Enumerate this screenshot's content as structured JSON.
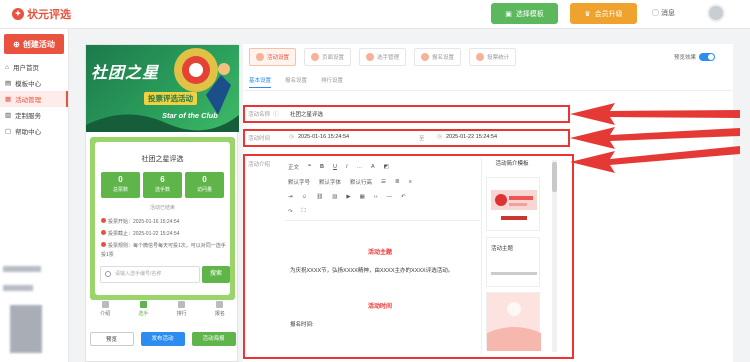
{
  "header": {
    "logo_text": "状元评选",
    "template_btn": "选择模板",
    "vip_btn": "会员升级",
    "message": "消息"
  },
  "sidebar": {
    "create": "创建活动",
    "items": [
      {
        "label": "用户首页",
        "active": false
      },
      {
        "label": "模板中心",
        "active": false
      },
      {
        "label": "活动管理",
        "active": true
      },
      {
        "label": "定制服务",
        "active": false
      },
      {
        "label": "帮助中心",
        "active": false
      }
    ]
  },
  "phone": {
    "banner_title": "社团之星",
    "banner_sub": "投票评选活动",
    "banner_en": "Star of the Club",
    "activity_title": "社团之星评选",
    "stats": [
      {
        "num": "0",
        "label": "总票数"
      },
      {
        "num": "6",
        "label": "选手数"
      },
      {
        "num": "0",
        "label": "访问量"
      }
    ],
    "ended": "活动已结束",
    "info": [
      "投票开始：2025-01-16 15:24:54",
      "投票截止：2025-01-22 15:24:54",
      "投票规则：每个微信号每天可投1次，可以对同一选手投1票"
    ],
    "search_placeholder": "请输入选手编号/名称",
    "search_btn": "搜索",
    "tabs": [
      "介绍",
      "选手",
      "排行",
      "报名"
    ],
    "btn_preview": "预览",
    "btn_publish": "发布活动",
    "btn_poster": "活动海报"
  },
  "panel": {
    "top_tabs": [
      "活动设置",
      "页面设置",
      "选手管理",
      "报名设置",
      "投票统计"
    ],
    "preview_label": "预览效果",
    "sub_tabs": [
      "基本设置",
      "报名设置",
      "排行设置"
    ],
    "name_label": "活动名称",
    "name_value": "社团之星评选",
    "time_label": "活动时间",
    "time_start": "2025-01-16 15:24:54",
    "time_sep": "至",
    "time_end": "2025-01-22 15:24:54",
    "intro_label": "活动介绍",
    "toolbar_row1": [
      "正文",
      "B",
      "I",
      "A",
      "…"
    ],
    "toolbar_row2": [
      "默认字号",
      "默认字体",
      "默认行高"
    ],
    "editor_h1": "活动主题",
    "editor_p1": "为庆祝XXXX节，弘扬XXXX精神，由XXXX主办的XXXX评选活动。",
    "editor_h2": "活动时间",
    "editor_p2": "报名时间:",
    "tpl_title": "活动简介模板",
    "tpl2_label": "活动主题"
  }
}
